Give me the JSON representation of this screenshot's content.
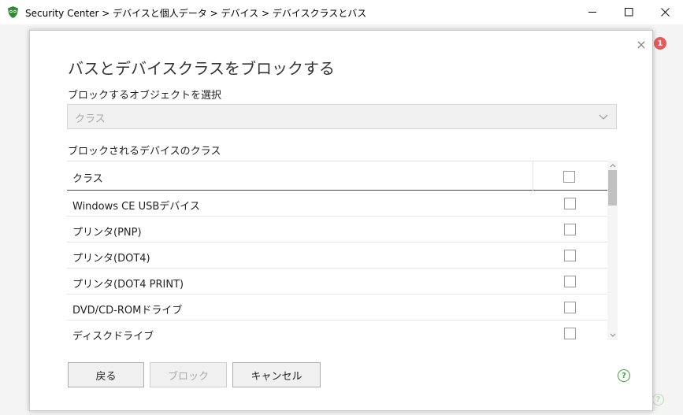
{
  "window": {
    "title": "Security Center > デバイスと個人データ > デバイス > デバイスクラスとバス",
    "app_icon": "shield-icon",
    "controls": [
      "minimize-icon",
      "maximize-icon",
      "close-icon"
    ]
  },
  "background": {
    "notification_count": "1",
    "help_glyph": "?"
  },
  "dialog": {
    "title": "バスとデバイスクラスをブロックする",
    "close_glyph": "×",
    "object_label": "ブロックするオブジェクトを選択",
    "object_select": {
      "value": "クラス",
      "disabled": true
    },
    "classes_label": "ブロックされるデバイスのクラス",
    "table": {
      "header": "クラス",
      "header_checked": false,
      "rows": [
        {
          "label": "Windows CE USBデバイス",
          "checked": false
        },
        {
          "label": "プリンタ(PNP)",
          "checked": false
        },
        {
          "label": "プリンタ(DOT4)",
          "checked": false
        },
        {
          "label": "プリンタ(DOT4 PRINT)",
          "checked": false
        },
        {
          "label": "DVD/CD-ROMドライブ",
          "checked": false
        },
        {
          "label": "ディスクドライブ",
          "checked": false
        }
      ]
    },
    "buttons": {
      "back": "戻る",
      "block": "ブロック",
      "cancel": "キャンセル"
    },
    "help_glyph": "?"
  },
  "colors": {
    "accent_green": "#3aa53a",
    "badge_red": "#e85a5a"
  }
}
